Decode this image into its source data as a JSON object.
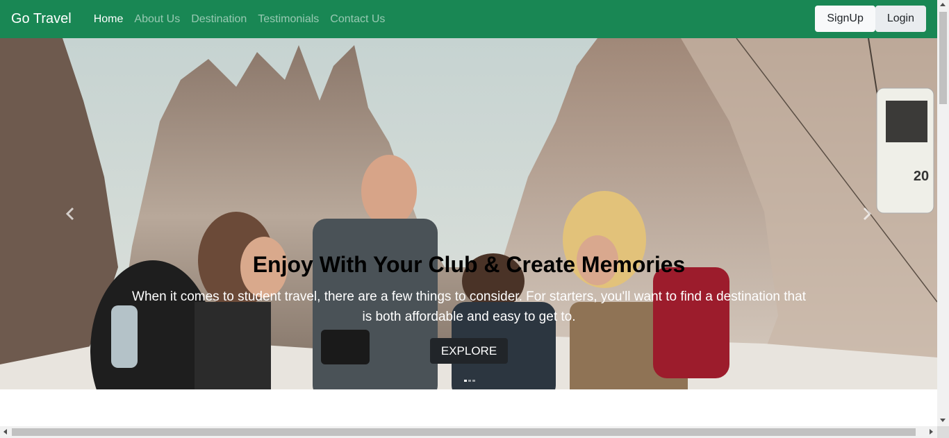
{
  "navbar": {
    "brand": "Go Travel",
    "links": [
      {
        "label": "Home",
        "active": true
      },
      {
        "label": "About Us"
      },
      {
        "label": "Destination"
      },
      {
        "label": "Testimonials"
      },
      {
        "label": "Contact Us"
      }
    ],
    "signup_label": "SignUp",
    "login_label": "Login",
    "color": "#198754"
  },
  "hero": {
    "heading": "Enjoy With Your Club & Create Memories",
    "text": "When it comes to student travel, there are a few things to consider. For starters, you'll want to find a destination that is both affordable and easy to get to.",
    "cta_label": "EXPLORE",
    "cabin_number": "20"
  }
}
